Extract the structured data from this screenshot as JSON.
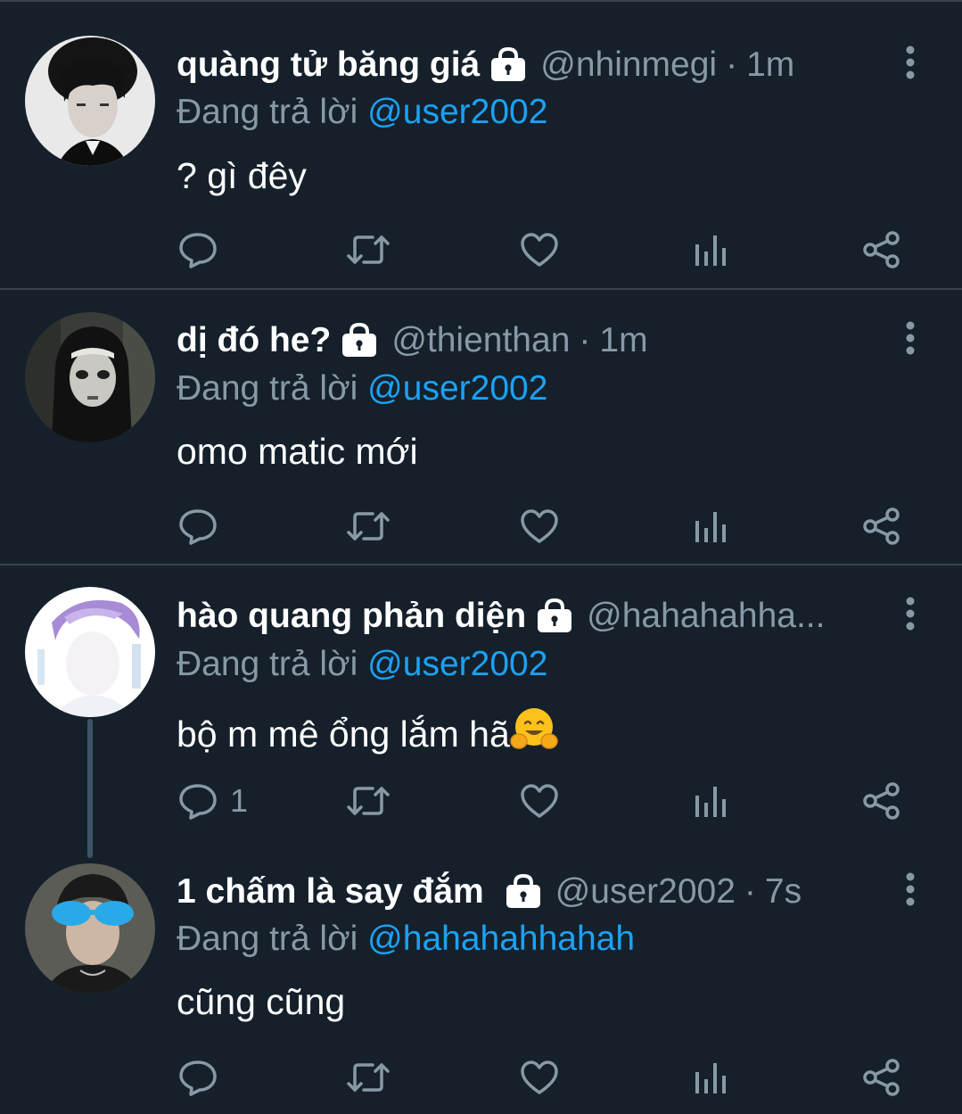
{
  "tweets": [
    {
      "display_name": "quàng tử băng giá",
      "handle": "@nhinmegi",
      "separator": "·",
      "time": "1m",
      "replying_prefix": "Đang trả lời",
      "replying_to": "@user2002",
      "text": "? gì đêy",
      "reply_count": ""
    },
    {
      "display_name": "dị đó he?",
      "handle": "@thienthan",
      "separator": "·",
      "time": "1m",
      "replying_prefix": "Đang trả lời",
      "replying_to": "@user2002",
      "text": "omo matic mới",
      "reply_count": ""
    },
    {
      "display_name": "hào quang phản diện",
      "handle": "@hahahahha...",
      "separator": "",
      "time": "",
      "replying_prefix": "Đang trả lời",
      "replying_to": "@user2002",
      "text": "bộ m mê ổng lắm hã",
      "emoji": "hugging-face-emoji",
      "reply_count": "1"
    },
    {
      "display_name": "1 chấm là say đắm",
      "handle": "@user2002",
      "separator": "·",
      "time": "7s",
      "replying_prefix": "Đang trả lời",
      "replying_to": "@hahahahhahah",
      "text": "cũng cũng",
      "reply_count": ""
    }
  ],
  "icons": {
    "protected": "lock-icon",
    "more": "more-vertical-icon",
    "reply": "reply-icon",
    "retweet": "retweet-icon",
    "like": "heart-icon",
    "analytics": "analytics-icon",
    "share": "share-icon"
  },
  "colors": {
    "background": "#15202b",
    "divider": "#38444d",
    "secondary_text": "#8899a6",
    "mention": "#1da1f2",
    "primary_text": "#ffffff"
  }
}
